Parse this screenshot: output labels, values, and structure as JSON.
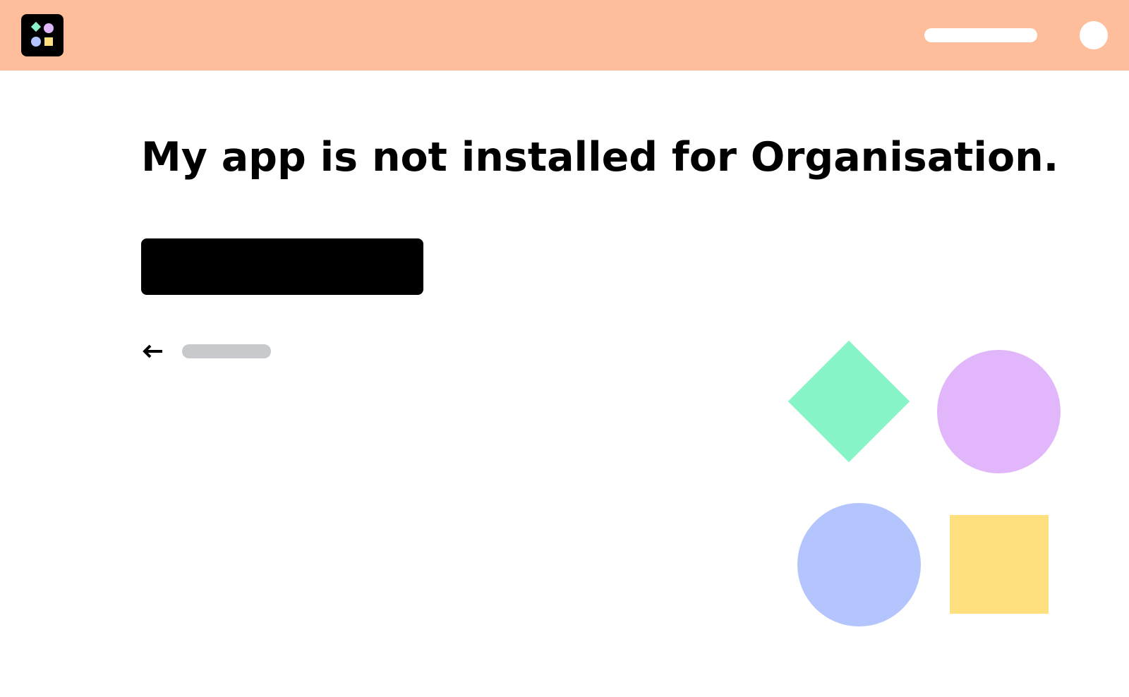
{
  "header": {
    "logo_icon": "app-grid-shapes-icon",
    "search_placeholder": "",
    "avatar_icon": "user-avatar-icon"
  },
  "main": {
    "title": "My app is not installed for Organisation.",
    "primary_button_label": "",
    "back_link": {
      "icon": "arrow-left-icon",
      "label": ""
    }
  },
  "illustration": {
    "shapes": [
      {
        "name": "diamond",
        "color": "#88F5C9"
      },
      {
        "name": "circle",
        "color": "#E2B6FB"
      },
      {
        "name": "circle",
        "color": "#B4C4FC"
      },
      {
        "name": "square",
        "color": "#FFE07F"
      }
    ]
  },
  "colors": {
    "header_background": "#FFBE9B",
    "primary_button": "#000000",
    "placeholder_gray": "#C8C9CC"
  }
}
